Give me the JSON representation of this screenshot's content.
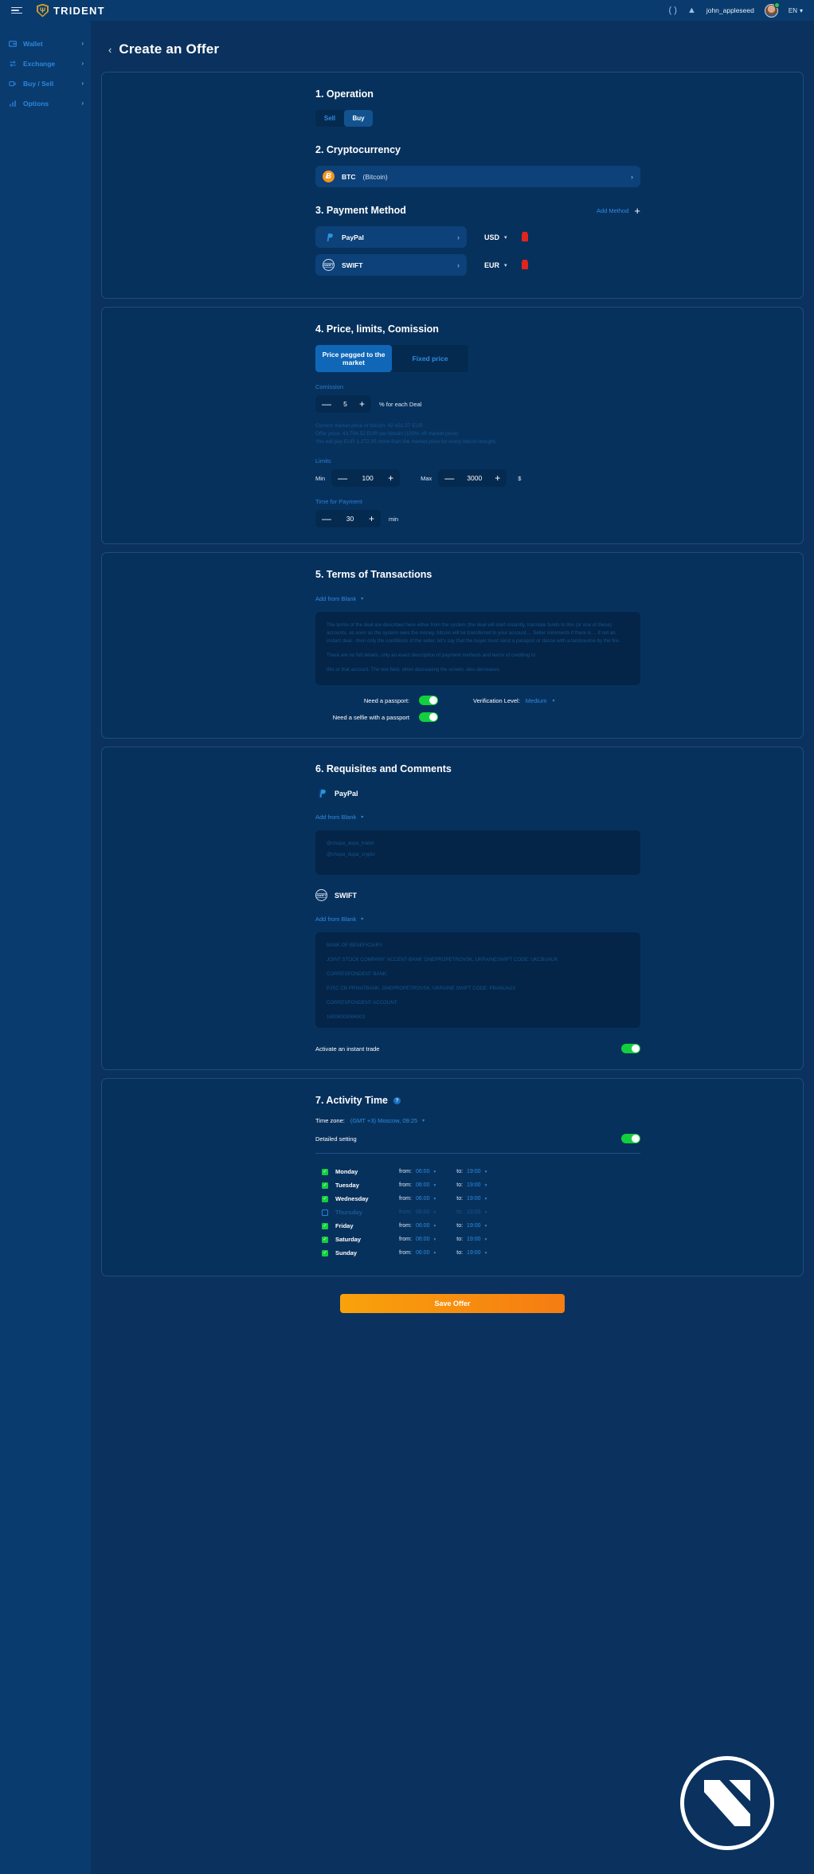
{
  "topbar": {
    "brand": "TRIDENT",
    "brand_mark": "Ψ",
    "username": "john_appleseed",
    "lang": "EN",
    "refresh_icon": "( )",
    "bell_icon": "▲"
  },
  "sidebar": {
    "items": [
      {
        "label": "Wallet",
        "icon": "wallet-icon",
        "arrow": "›"
      },
      {
        "label": "Exchange",
        "icon": "exchange-icon",
        "arrow": "›"
      },
      {
        "label": "Buy / Sell",
        "icon": "buysell-icon",
        "arrow": "›"
      },
      {
        "label": "Options",
        "icon": "options-icon",
        "arrow": "›"
      }
    ]
  },
  "page": {
    "back": "‹",
    "title": "Create an Offer"
  },
  "operation": {
    "title": "1. Operation",
    "options": [
      "Sell",
      "Buy"
    ],
    "selected": "Buy"
  },
  "cryptocurrency": {
    "title": "2. Cryptocurrency",
    "symbol": "BTC",
    "name": "(Bitcoin)",
    "badge": "Ƀ",
    "chevron": "›"
  },
  "payment_method": {
    "title": "3. Payment Method",
    "add_label": "Add Method",
    "add_plus": "+",
    "methods": [
      {
        "name": "PayPal",
        "icon": "paypal-icon",
        "currency": "USD",
        "caret": "▾",
        "chevron": "›"
      },
      {
        "name": "SWIFT",
        "icon": "swift-icon",
        "currency": "EUR",
        "caret": "▾",
        "chevron": "›"
      }
    ]
  },
  "price": {
    "title": "4. Price, limits, Comission",
    "modes": [
      "Price pegged to the market",
      "Fixed price"
    ],
    "selected_mode": "Price pegged to the market",
    "commission_label": "Comission",
    "commission_value": "5",
    "commission_unit": "% for each Deal",
    "notes": [
      "Current market price of bitcoin: 42 431.57 EUR",
      "Offer price: 43,704.52 EUR per bitcoin (103% off market price)",
      "You will pay EUR 1,272.95 more than the market price for every bitcoin bought."
    ],
    "limits_label": "Limits",
    "min_label": "Min",
    "min_value": "100",
    "max_label": "Max",
    "max_value": "3000",
    "limits_unit": "$",
    "time_label": "Time for Payment",
    "time_value": "30",
    "time_unit": "min",
    "minus": "—",
    "plus": "+"
  },
  "terms": {
    "title": "5. Terms of Transactions",
    "add_from_blank": "Add from Blank",
    "caret": "▾",
    "paragraphs": [
      "The terms of the deal are described here either from the system (the deal will start instantly, translate funds to this (or one of these) accounts, as soon as the system sees the money, bitcoin will be transferred to your account.... Seller comments if there is ... if not an instant deal - then only the conditions of the seller, let's say that the buyer must send a passport or dance with a tambourine by the fire.",
      "There are no full details, only an exact description of payment methods and terms of crediting to",
      "this or that account. The text field, when decreasing the screen, also decreases"
    ],
    "need_passport_label": "Need a passport:",
    "need_passport_on": true,
    "need_selfie_label": "Need a selfie with a passport",
    "need_selfie_on": true,
    "verification_label": "Verification Level:",
    "verification_value": "Medium"
  },
  "requisites": {
    "title": "6. Requisites and Comments",
    "add_from_blank": "Add from Blank",
    "caret": "▾",
    "paypal_name": "PayPal",
    "paypal_lines": [
      "@chupa_dupa_trader",
      "@chupa_dupa_crypto"
    ],
    "swift_name": "SWIFT",
    "swift_lines": [
      "BANK OF BENEFICIARY:",
      "JOINT STOCK COMPANY 'ACCENT-BANK' DNEPROPETROVSK, UKRAINESWIFT CODE: UKCBUAUK",
      "CORRESPONDENT BANK:",
      "PJSC CB PRIVATBANK, DNEPROPETROVSK, UKRAINE  SWIFT CODE: PBANUA2X",
      "CORRESPONDENT ACCOUNT:",
      "16008003064003"
    ],
    "instant_trade_label": "Activate an instant trade",
    "instant_trade_on": true
  },
  "activity": {
    "title": "7. Activity Time",
    "help_icon": "?",
    "timezone_label": "Time zone:",
    "timezone_value": "(GMT +3) Moscow, 09:25",
    "caret": "▾",
    "detailed_label": "Detailed setting",
    "detailed_on": true,
    "from_label": "from:",
    "to_label": "to:",
    "days": [
      {
        "name": "Monday",
        "checked": true,
        "from": "06:00",
        "to": "19:00"
      },
      {
        "name": "Tuesday",
        "checked": true,
        "from": "06:00",
        "to": "19:00"
      },
      {
        "name": "Wednesday",
        "checked": true,
        "from": "06:00",
        "to": "19:00"
      },
      {
        "name": "Thursday",
        "checked": false,
        "from": "06:00",
        "to": "19:00"
      },
      {
        "name": "Friday",
        "checked": true,
        "from": "06:00",
        "to": "19:00"
      },
      {
        "name": "Saturday",
        "checked": true,
        "from": "06:00",
        "to": "19:00"
      },
      {
        "name": "Sunday",
        "checked": true,
        "from": "06:00",
        "to": "19:00"
      }
    ],
    "check_glyph": "✓"
  },
  "footer": {
    "save_label": "Save Offer"
  },
  "colors": {
    "accent_blue": "#2e8ce0",
    "toggle_green": "#13cf3d",
    "btc_orange": "#f7931a",
    "save_orange": "#f57c12",
    "delete_red": "#e3241c"
  }
}
